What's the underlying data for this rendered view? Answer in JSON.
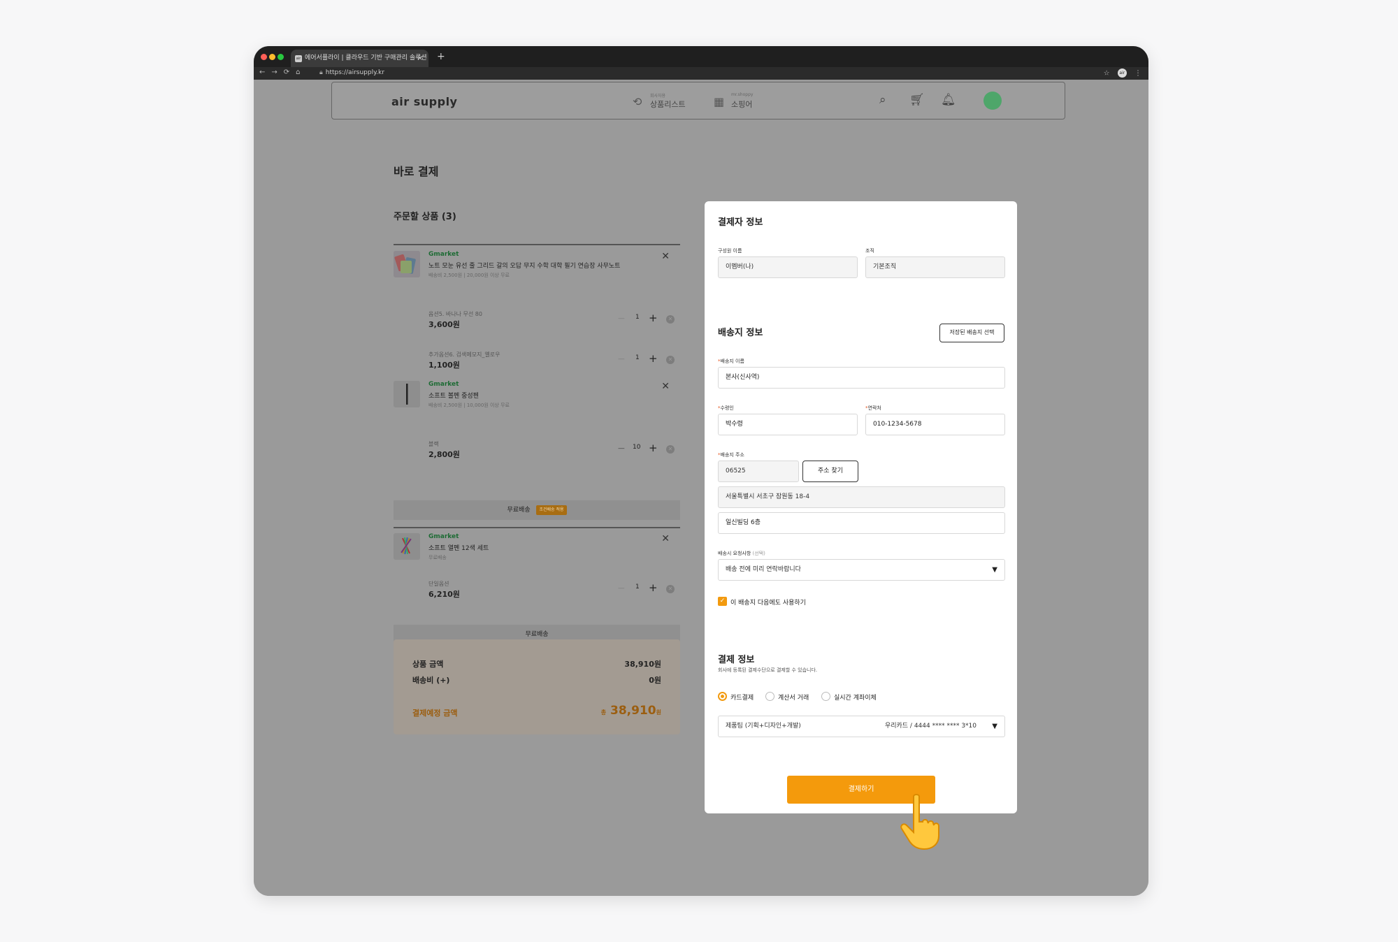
{
  "browser": {
    "tab_title": "에어서플라이 | 클라우드 기반 구매관리 솔루션",
    "tab_favicon": "air",
    "tab_close": "×",
    "new_tab": "+",
    "url": "https://airsupply.kr",
    "profile": "air"
  },
  "header": {
    "logo": "air supply",
    "nav": [
      {
        "sub": "회사자용",
        "label": "상품리스트",
        "icon": "product-list-icon"
      },
      {
        "sub": "mr.shoppy",
        "label": "소핑어",
        "icon": "store-icon"
      }
    ],
    "icons": [
      "search-icon",
      "cart-icon",
      "bell-icon"
    ]
  },
  "page": {
    "title": "바로 결제",
    "order_title": "주문할 상품 (3)"
  },
  "products": [
    {
      "seller": "Gmarket",
      "name": "노트 모눈 유선 줄 그리드 갈의 오답 무지 수학 대학 필기 연습장 사무노트",
      "shipping": "배송비 2,500원 | 20,000원 이상 무료",
      "options": [
        {
          "name": "옵션5. 바나나 무선 80",
          "price": "3,600원",
          "qty": "1"
        },
        {
          "name": "추가옵션6. 검색메모지_옐로우",
          "price": "1,100원",
          "qty": "1"
        }
      ]
    },
    {
      "seller": "Gmarket",
      "name": "소프트 볼펜 중성펜",
      "shipping": "배송비 2,500원 | 10,000원 이상 무료",
      "options": [
        {
          "name": "블랙",
          "price": "2,800원",
          "qty": "10"
        }
      ],
      "free_label": "무료배송",
      "free_badge": "조건배송 적용"
    },
    {
      "seller": "Gmarket",
      "name": "소프트 열펜 12색 세트",
      "shipping": "무료배송",
      "options": [
        {
          "name": "단일옵션",
          "price": "6,210원",
          "qty": "1"
        }
      ],
      "free_label": "무료배송"
    }
  ],
  "summary": {
    "product_amount_label": "상품 금액",
    "product_amount": "38,910원",
    "shipping_label": "배송비 (+)",
    "shipping": "0원",
    "total_label": "결제예정 금액",
    "total_prefix": "총",
    "total": "38,910",
    "total_unit": "원"
  },
  "payer": {
    "title": "결제자 정보",
    "member_label": "구성원 이름",
    "member_value": "이멤버(나)",
    "org_label": "조직",
    "org_value": "기본조직"
  },
  "shipping": {
    "title": "배송지 정보",
    "saved_button": "저장된 배송지 선택",
    "name_label": "배송지 이름",
    "name_value": "본사(신사역)",
    "receiver_label": "수령인",
    "receiver_value": "박수령",
    "phone_label": "연락처",
    "phone_value": "010-1234-5678",
    "address_label": "배송지 주소",
    "zipcode": "06525",
    "find_button": "주소 찾기",
    "address1": "서울특별시 서초구 잠원동 18-4",
    "address2": "일신빌딩 6층",
    "request_label": "배송시 요청사항",
    "request_optional": "(선택)",
    "request_value": "배송 전에 미리 연락바랍니다",
    "reuse_label": "이 배송지 다음에도 사용하기",
    "reuse_checked": true
  },
  "payment": {
    "title": "결제 정보",
    "description": "회사에 등록된 결제수단으로 결제할 수 있습니다.",
    "methods": [
      "카드결제",
      "계산서 거래",
      "실시간 계좌이체"
    ],
    "selected_method": "카드결제",
    "card_owner": "제품팀 (기획+디자인+개발)",
    "card_number": "우리카드 / 4444 **** **** 3*10",
    "submit": "결제하기"
  },
  "colors": {
    "accent": "#f49a0c",
    "overlay": "#9a9a9a",
    "avatar": "#4ea66a",
    "seller": "#1d6b34"
  }
}
